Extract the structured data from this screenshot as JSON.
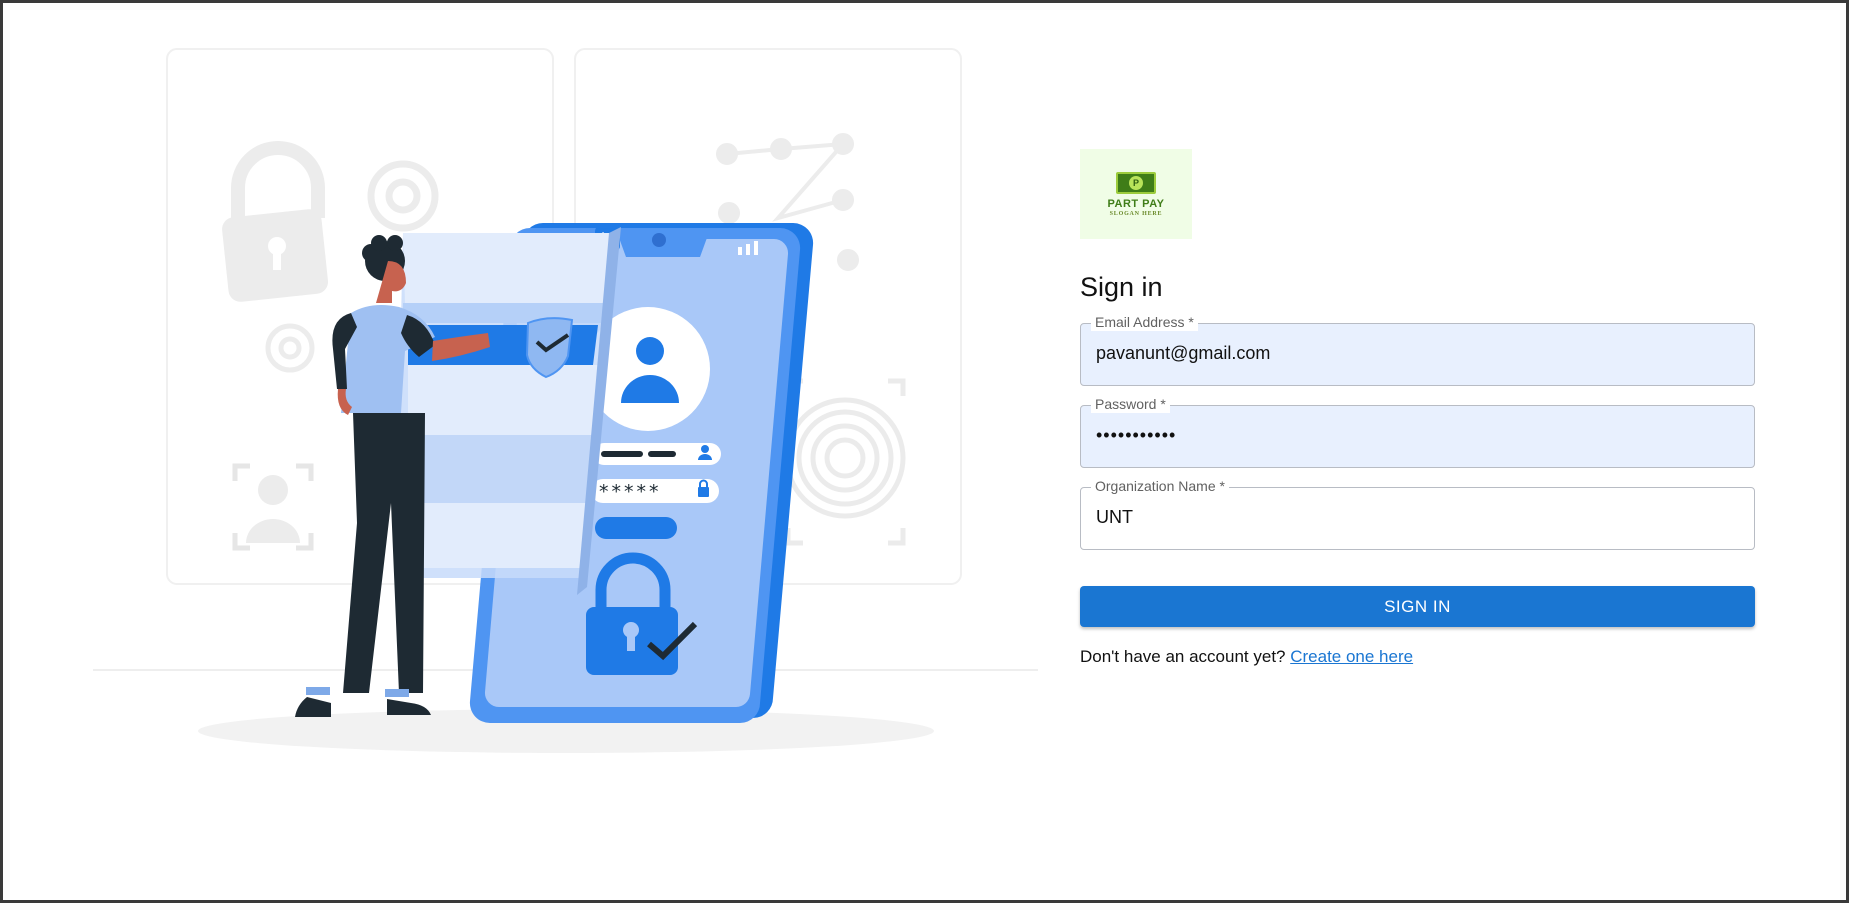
{
  "logo": {
    "name": "PART PAY",
    "slogan": "SLOGAN HERE",
    "bill_letter": "P"
  },
  "signin": {
    "title": "Sign in",
    "email": {
      "label": "Email Address *",
      "value": "pavanunt@gmail.com"
    },
    "password": {
      "label": "Password *",
      "value": "•••••••••••"
    },
    "organization": {
      "label": "Organization Name *",
      "value": "UNT"
    },
    "button_label": "SIGN IN",
    "footer_text": "Don't have an account yet? ",
    "footer_link": "Create one here"
  },
  "illustration": {
    "password_mask": "*****"
  },
  "colors": {
    "primary": "#1a76d2",
    "input_fill": "#e8f0fe",
    "illustration_blue": "#1f7ae6",
    "illustration_light": "#a9c8f8",
    "logo_bg": "#f0fde6"
  },
  "icons": [
    "lock-icon",
    "gear-icon",
    "fingerprint-icon",
    "user-icon",
    "close-icon",
    "checkmark-icon",
    "shield-icon"
  ]
}
